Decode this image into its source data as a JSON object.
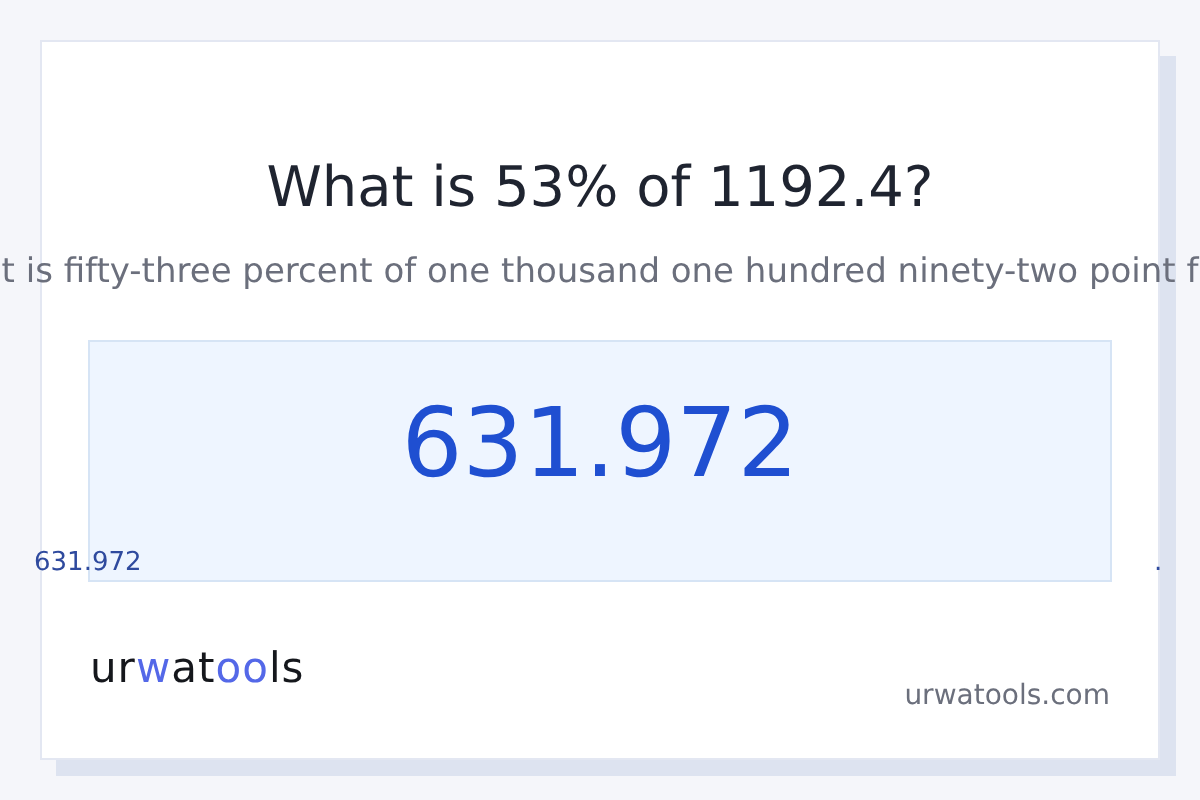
{
  "title": "What is 53% of 1192.4?",
  "subtitle": "t is fifty-three percent of one thousand one hundred ninety-two point f",
  "result": "631.972",
  "stray_texts": [
    {
      "text": "631.972",
      "kind": "number"
    },
    {
      "text": ".",
      "kind": "dot"
    }
  ],
  "logo": [
    {
      "text": "ur",
      "accent": false
    },
    {
      "text": "w",
      "accent": true
    },
    {
      "text": "at",
      "accent": false
    },
    {
      "text": "oo",
      "accent": true
    },
    {
      "text": "ls",
      "accent": false
    }
  ],
  "site": "urwatools.com"
}
